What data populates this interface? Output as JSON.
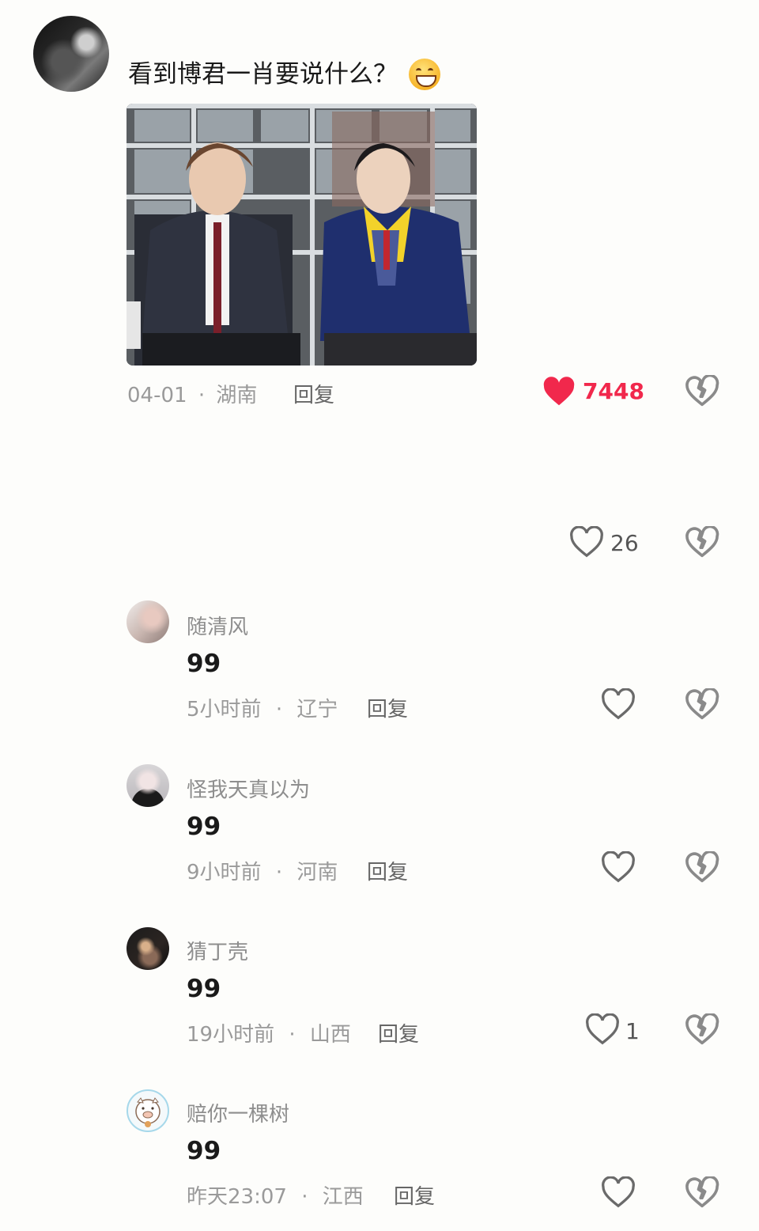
{
  "main_comment": {
    "text": "看到博君一肖要说什么？",
    "emoji": "grinning-face-emoji",
    "date": "04-01",
    "location": "湖南",
    "reply_label": "回复",
    "like_count": "7448",
    "like_color": "#f1284c"
  },
  "thread_action": {
    "like_count": "26"
  },
  "replies": [
    {
      "name": "随清风",
      "text": "99",
      "time": "5小时前",
      "location": "辽宁",
      "reply_label": "回复",
      "like_count": ""
    },
    {
      "name": "怪我天真以为",
      "text": "99",
      "time": "9小时前",
      "location": "河南",
      "reply_label": "回复",
      "like_count": ""
    },
    {
      "name": "猜丁壳",
      "text": "99",
      "time": "19小时前",
      "location": "山西",
      "reply_label": "回复",
      "like_count": "1"
    },
    {
      "name": "赔你一棵树",
      "text": "99",
      "time": "昨天23:07",
      "location": "江西",
      "reply_label": "回复",
      "like_count": ""
    }
  ],
  "separator": "·"
}
